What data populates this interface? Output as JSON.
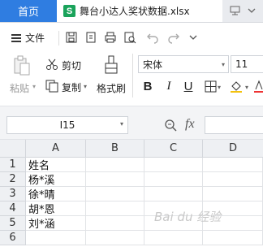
{
  "tabs": {
    "home_label": "首页",
    "file_icon_letter": "S",
    "document_title": "舞台小达人奖状数据.xlsx"
  },
  "menu": {
    "file_label": "文件"
  },
  "ribbon": {
    "paste_label": "粘贴",
    "cut_label": "剪切",
    "copy_label": "复制",
    "format_painter_label": "格式刷",
    "font_name": "宋体",
    "font_size": "11",
    "bold": "B",
    "italic": "I",
    "underline": "U"
  },
  "formula_bar": {
    "cell_ref": "I15",
    "fx": "fx"
  },
  "sheet": {
    "columns": [
      "A",
      "B",
      "C",
      "D"
    ],
    "rows": [
      "1",
      "2",
      "3",
      "4",
      "5",
      "6"
    ],
    "col_a": [
      "姓名",
      "杨*溪",
      "徐*晴",
      "胡*恩",
      "刘*涵",
      ""
    ]
  },
  "watermark": "Bai du 经验",
  "colors": {
    "accent": "#2f7de1",
    "sheet_icon": "#1aa35b"
  }
}
